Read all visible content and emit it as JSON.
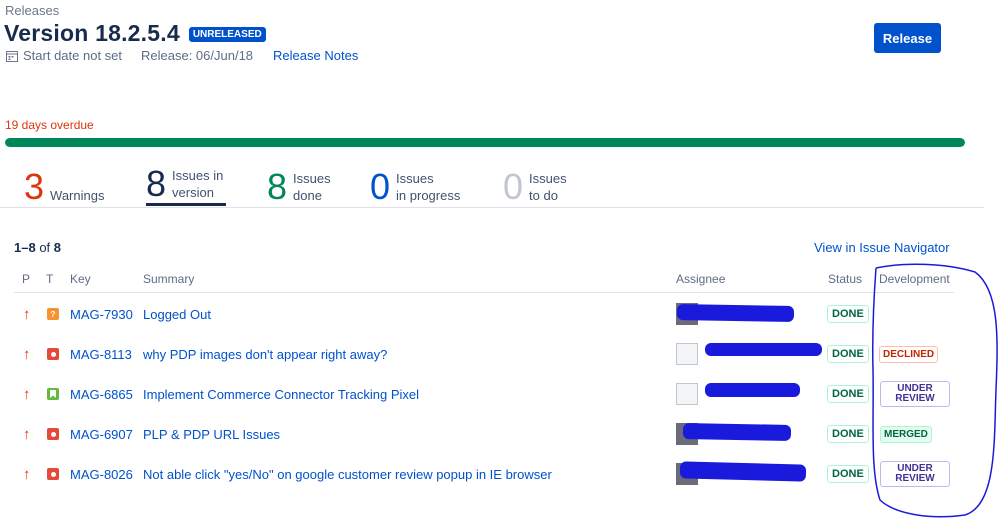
{
  "breadcrumb": "Releases",
  "version_title": "Version 18.2.5.4",
  "version_status": "UNRELEASED",
  "start_date": "Start date not set",
  "release_date": "Release: 06/Jun/18",
  "release_notes_link": "Release Notes",
  "release_button": "Release",
  "overdue_text": "19 days overdue",
  "progress": {
    "done_fraction": 1.0,
    "color": "#00875a"
  },
  "stats": [
    {
      "value": "3",
      "label_line1": "",
      "label_line2": "Warnings",
      "color": "#de350b",
      "active": false
    },
    {
      "value": "8",
      "label_line1": "Issues in",
      "label_line2": "version",
      "color": "#172b4d",
      "active": true
    },
    {
      "value": "8",
      "label_line1": "Issues",
      "label_line2": "done",
      "color": "#00875a",
      "active": false
    },
    {
      "value": "0",
      "label_line1": "Issues",
      "label_line2": "in progress",
      "color": "#0052cc",
      "active": false
    },
    {
      "value": "0",
      "label_line1": "Issues",
      "label_line2": "to do",
      "color": "#c1c7d0",
      "active": false
    }
  ],
  "list": {
    "range": "1–8",
    "of_text": "of",
    "total": "8",
    "navigator_link": "View in Issue Navigator",
    "columns": {
      "p": "P",
      "t": "T",
      "key": "Key",
      "summary": "Summary",
      "assignee": "Assignee",
      "status": "Status",
      "development": "Development"
    },
    "rows": [
      {
        "priority_icon": "arrow-up-icon",
        "type": "question",
        "type_color": "#f79232",
        "key": "MAG-7930",
        "summary": "Logged Out",
        "assignee": "",
        "avatar": "photo",
        "status": "DONE",
        "development": ""
      },
      {
        "priority_icon": "arrow-up-icon",
        "type": "bug",
        "type_color": "#e5493a",
        "key": "MAG-8113",
        "summary": "why PDP images don't appear right away?",
        "assignee": "",
        "avatar": "broken-image",
        "status": "DONE",
        "development": "DECLINED"
      },
      {
        "priority_icon": "arrow-up-icon",
        "type": "story",
        "type_color": "#63ba3c",
        "key": "MAG-6865",
        "summary": "Implement Commerce Connector Tracking Pixel",
        "assignee": "",
        "avatar": "broken-image",
        "status": "DONE",
        "development": "UNDER REVIEW"
      },
      {
        "priority_icon": "arrow-up-icon",
        "type": "bug",
        "type_color": "#e5493a",
        "key": "MAG-6907",
        "summary": "PLP & PDP URL Issues",
        "assignee": "",
        "avatar": "photo",
        "status": "DONE",
        "development": "MERGED"
      },
      {
        "priority_icon": "arrow-up-icon",
        "type": "bug",
        "type_color": "#e5493a",
        "key": "MAG-8026",
        "summary": "Not able click \"yes/No\" on google customer review popup in IE browser",
        "assignee": "",
        "avatar": "photo",
        "status": "DONE",
        "development": "UNDER REVIEW"
      }
    ]
  },
  "colors": {
    "link": "#0052cc",
    "accent": "#0052cc",
    "annotation": "#1a1adc"
  }
}
